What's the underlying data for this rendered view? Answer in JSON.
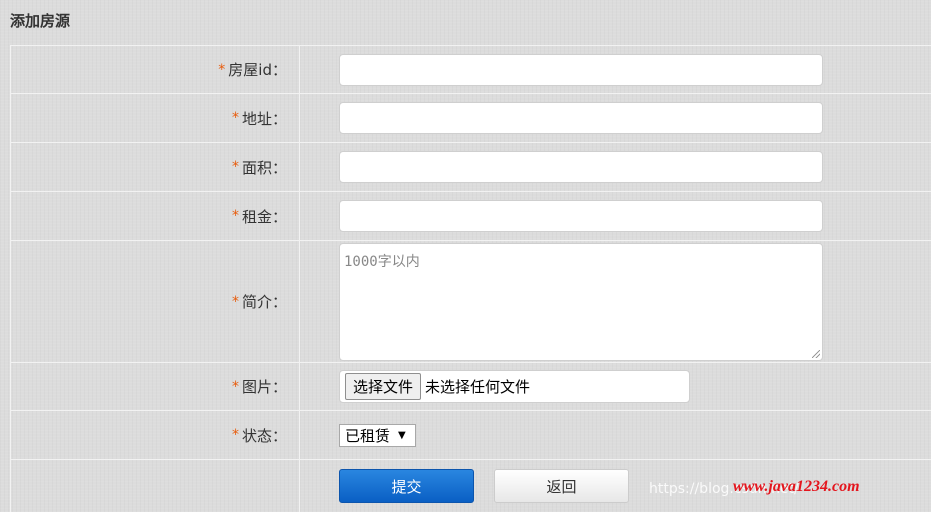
{
  "page_title": "添加房源",
  "required_mark": "*",
  "fields": [
    {
      "label": "房屋id：",
      "value": ""
    },
    {
      "label": "地址：",
      "value": ""
    },
    {
      "label": "面积：",
      "value": ""
    },
    {
      "label": "租金：",
      "value": ""
    }
  ],
  "intro": {
    "label": "简介：",
    "placeholder": "1000字以内"
  },
  "image": {
    "label": "图片：",
    "button_label": "选择文件",
    "status": "未选择任何文件"
  },
  "status": {
    "label": "状态：",
    "selected": "已租赁"
  },
  "buttons": {
    "submit": "提交",
    "back": "返回"
  },
  "watermark": {
    "text": "https://blog.csdn.net/",
    "site": "www.java1234.com"
  },
  "colors": {
    "required": "#e85c0c",
    "submit_bg": "#0a5fc4"
  }
}
